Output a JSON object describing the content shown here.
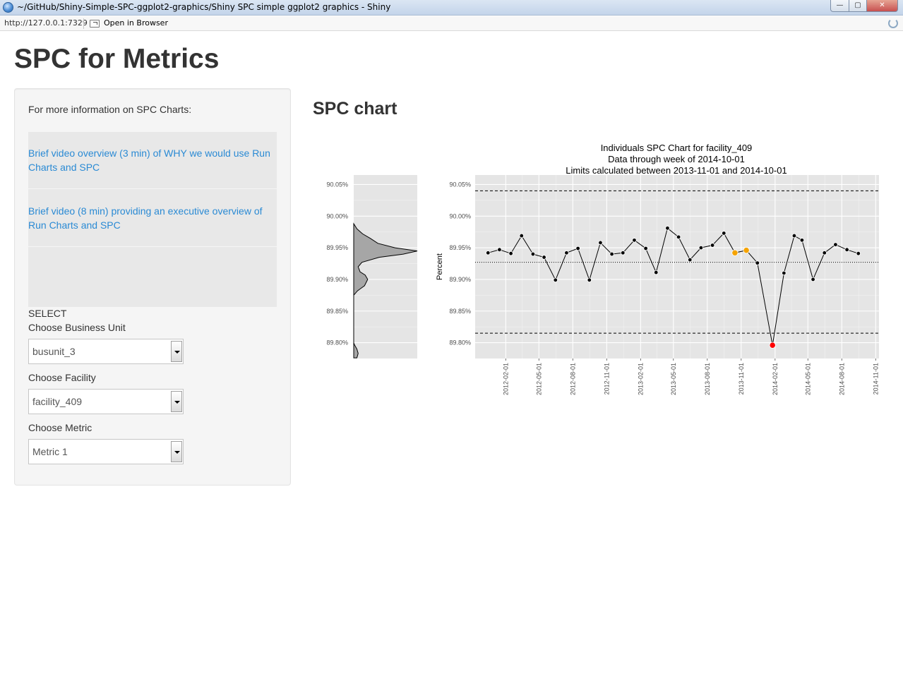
{
  "window": {
    "title": "~/GitHub/Shiny-Simple-SPC-ggplot2-graphics/Shiny SPC simple ggplot2 graphics - Shiny",
    "minimize_symbol": "—",
    "maximize_symbol": "▢",
    "close_symbol": "✕"
  },
  "address_bar": {
    "url": "http://127.0.0.1:7329",
    "open_in_browser_label": "Open in Browser"
  },
  "page": {
    "title": "SPC for Metrics",
    "chart_heading": "SPC chart"
  },
  "sidebar": {
    "info_text": "For more information on SPC Charts:",
    "links": [
      {
        "label": "Brief video overview (3 min) of WHY we would use Run Charts and SPC"
      },
      {
        "label": "Brief video (8 min) providing an executive overview of Run Charts and SPC"
      }
    ],
    "select_heading": "SELECT",
    "business_unit": {
      "label": "Choose Business Unit",
      "value": "busunit_3"
    },
    "facility": {
      "label": "Choose Facility",
      "value": "facility_409"
    },
    "metric": {
      "label": "Choose Metric",
      "value": "Metric 1"
    }
  },
  "colors": {
    "link": "#2a8ad4",
    "panel_bg": "#e5e5e5",
    "point_normal": "#000000",
    "point_warning": "#f5a300",
    "point_out_of_control": "#ff0000"
  },
  "chart_data": {
    "type": "line",
    "title_lines": [
      "Individuals SPC Chart for  facility_409",
      "Data through week of 2014-10-01",
      "Limits calculated between 2013-11-01 and 2014-10-01"
    ],
    "ylabel": "Percent",
    "xlabel": "",
    "ylim": [
      89.775,
      90.065
    ],
    "y_ticks": [
      {
        "value": 90.05,
        "label": "90.05%"
      },
      {
        "value": 90.0,
        "label": "90.00%"
      },
      {
        "value": 89.95,
        "label": "89.95%"
      },
      {
        "value": 89.9,
        "label": "89.90%"
      },
      {
        "value": 89.85,
        "label": "89.85%"
      },
      {
        "value": 89.8,
        "label": "89.80%"
      }
    ],
    "x_range": [
      "2011-11-10",
      "2014-11-10"
    ],
    "x_ticks": [
      "2012-02-01",
      "2012-05-01",
      "2012-08-01",
      "2012-11-01",
      "2013-02-01",
      "2013-05-01",
      "2013-08-01",
      "2013-11-01",
      "2014-02-01",
      "2014-05-01",
      "2014-08-01",
      "2014-11-01"
    ],
    "center_line": 89.927,
    "upper_control_limit": 90.04,
    "lower_control_limit": 89.815,
    "grid": true,
    "series": [
      {
        "points": [
          {
            "date": "2011-12-15",
            "value": 89.942,
            "status": "normal"
          },
          {
            "date": "2012-01-15",
            "value": 89.947,
            "status": "normal"
          },
          {
            "date": "2012-02-15",
            "value": 89.941,
            "status": "normal"
          },
          {
            "date": "2012-03-15",
            "value": 89.969,
            "status": "normal"
          },
          {
            "date": "2012-04-15",
            "value": 89.94,
            "status": "normal"
          },
          {
            "date": "2012-05-15",
            "value": 89.935,
            "status": "normal"
          },
          {
            "date": "2012-06-15",
            "value": 89.899,
            "status": "normal"
          },
          {
            "date": "2012-07-15",
            "value": 89.942,
            "status": "normal"
          },
          {
            "date": "2012-08-15",
            "value": 89.949,
            "status": "normal"
          },
          {
            "date": "2012-09-15",
            "value": 89.899,
            "status": "normal"
          },
          {
            "date": "2012-10-15",
            "value": 89.958,
            "status": "normal"
          },
          {
            "date": "2012-11-15",
            "value": 89.94,
            "status": "normal"
          },
          {
            "date": "2012-12-15",
            "value": 89.942,
            "status": "normal"
          },
          {
            "date": "2013-01-15",
            "value": 89.962,
            "status": "normal"
          },
          {
            "date": "2013-02-15",
            "value": 89.949,
            "status": "normal"
          },
          {
            "date": "2013-03-15",
            "value": 89.911,
            "status": "normal"
          },
          {
            "date": "2013-04-15",
            "value": 89.981,
            "status": "normal"
          },
          {
            "date": "2013-05-15",
            "value": 89.967,
            "status": "normal"
          },
          {
            "date": "2013-06-15",
            "value": 89.931,
            "status": "normal"
          },
          {
            "date": "2013-07-15",
            "value": 89.95,
            "status": "normal"
          },
          {
            "date": "2013-08-15",
            "value": 89.954,
            "status": "normal"
          },
          {
            "date": "2013-09-15",
            "value": 89.973,
            "status": "normal"
          },
          {
            "date": "2013-10-15",
            "value": 89.942,
            "status": "warning"
          },
          {
            "date": "2013-11-15",
            "value": 89.946,
            "status": "warning"
          },
          {
            "date": "2013-12-15",
            "value": 89.926,
            "status": "normal"
          },
          {
            "date": "2014-01-25",
            "value": 89.796,
            "status": "out_of_control"
          },
          {
            "date": "2014-02-25",
            "value": 89.91,
            "status": "normal"
          },
          {
            "date": "2014-03-25",
            "value": 89.969,
            "status": "normal"
          },
          {
            "date": "2014-04-15",
            "value": 89.962,
            "status": "normal"
          },
          {
            "date": "2014-05-15",
            "value": 89.9,
            "status": "normal"
          },
          {
            "date": "2014-06-15",
            "value": 89.942,
            "status": "normal"
          },
          {
            "date": "2014-07-15",
            "value": 89.955,
            "status": "normal"
          },
          {
            "date": "2014-08-15",
            "value": 89.947,
            "status": "normal"
          },
          {
            "date": "2014-09-15",
            "value": 89.941,
            "status": "normal"
          }
        ]
      }
    ],
    "density": {
      "type": "area",
      "y_ticks": [
        "90.05%",
        "90.00%",
        "89.95%",
        "89.90%",
        "89.85%",
        "89.80%"
      ],
      "curve": [
        {
          "y": 89.776,
          "d": 0.05
        },
        {
          "y": 89.783,
          "d": 0.07
        },
        {
          "y": 89.79,
          "d": 0.05
        },
        {
          "y": 89.797,
          "d": 0.01
        },
        {
          "y": 89.8,
          "d": 0.0
        },
        {
          "y": 89.875,
          "d": 0.0
        },
        {
          "y": 89.882,
          "d": 0.06
        },
        {
          "y": 89.89,
          "d": 0.17
        },
        {
          "y": 89.9,
          "d": 0.22
        },
        {
          "y": 89.907,
          "d": 0.18
        },
        {
          "y": 89.912,
          "d": 0.1
        },
        {
          "y": 89.92,
          "d": 0.07
        },
        {
          "y": 89.927,
          "d": 0.13
        },
        {
          "y": 89.935,
          "d": 0.4
        },
        {
          "y": 89.94,
          "d": 0.78
        },
        {
          "y": 89.945,
          "d": 1.0
        },
        {
          "y": 89.95,
          "d": 0.65
        },
        {
          "y": 89.957,
          "d": 0.38
        },
        {
          "y": 89.965,
          "d": 0.26
        },
        {
          "y": 89.972,
          "d": 0.14
        },
        {
          "y": 89.98,
          "d": 0.05
        },
        {
          "y": 89.988,
          "d": 0.0
        }
      ]
    }
  }
}
